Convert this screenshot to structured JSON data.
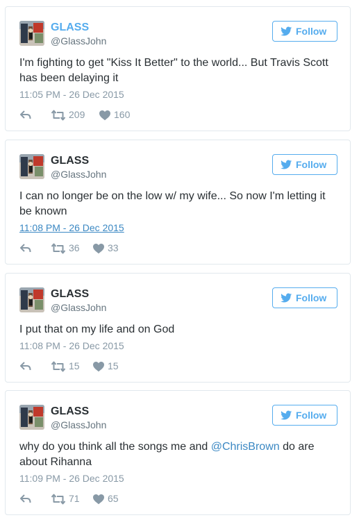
{
  "colors": {
    "accent": "#55acee",
    "link": "#3b88c3",
    "text": "#292f33",
    "muted": "#8899a6",
    "border": "#e1e8ed"
  },
  "icons": {
    "follow": "bird-icon",
    "reply": "reply-icon",
    "retweet": "retweet-icon",
    "like": "heart-icon"
  },
  "tweets": [
    {
      "display_name": "GLASS",
      "username": "@GlassJohn",
      "follow_label": "Follow",
      "text_parts": [
        "I'm fighting to get \"Kiss It Better\" to the world... But Travis Scott has been delaying it"
      ],
      "timestamp": "11:05 PM - 26 Dec 2015",
      "retweets": "209",
      "likes": "160"
    },
    {
      "display_name": "GLASS",
      "username": "@GlassJohn",
      "follow_label": "Follow",
      "text_parts": [
        "I can no longer be on the low w/ my wife... So now I'm letting it be known"
      ],
      "timestamp": "11:08 PM - 26 Dec 2015",
      "retweets": "36",
      "likes": "33"
    },
    {
      "display_name": "GLASS",
      "username": "@GlassJohn",
      "follow_label": "Follow",
      "text_parts": [
        "I put that on my life and on God"
      ],
      "timestamp": "11:08 PM - 26 Dec 2015",
      "retweets": "15",
      "likes": "15"
    },
    {
      "display_name": "GLASS",
      "username": "@GlassJohn",
      "follow_label": "Follow",
      "text_parts": [
        "why do you think all the songs me and ",
        "@ChrisBrown",
        " do are about Rihanna"
      ],
      "timestamp": "11:09 PM - 26 Dec 2015",
      "retweets": "71",
      "likes": "65"
    }
  ]
}
